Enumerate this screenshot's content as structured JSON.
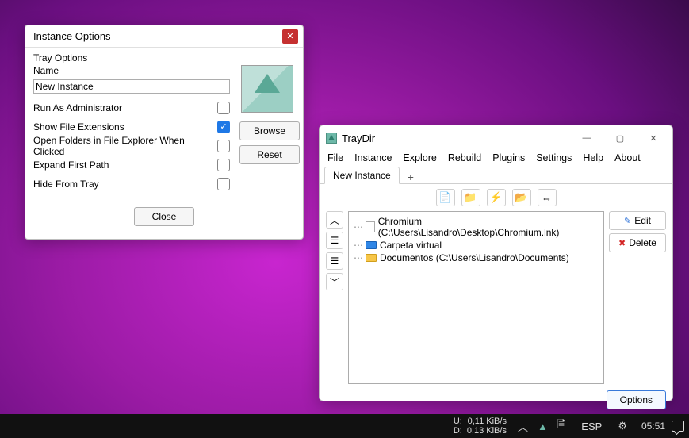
{
  "instance_options": {
    "title": "Instance Options",
    "section_label": "Tray Options",
    "name_label": "Name",
    "name_value": "New Instance",
    "checks": [
      {
        "label": "Run As Administrator",
        "checked": false
      },
      {
        "label": "Show File Extensions",
        "checked": true
      },
      {
        "label": "Open Folders in File Explorer When Clicked",
        "checked": false
      },
      {
        "label": "Expand First Path",
        "checked": false
      },
      {
        "label": "Hide From Tray",
        "checked": false
      }
    ],
    "browse_label": "Browse",
    "reset_label": "Reset",
    "close_label": "Close"
  },
  "main_window": {
    "title": "TrayDir",
    "menu": [
      "File",
      "Instance",
      "Explore",
      "Rebuild",
      "Plugins",
      "Settings",
      "Help",
      "About"
    ],
    "tab_label": "New Instance",
    "icon_names": [
      "new-item",
      "folder-add",
      "folder-flash",
      "folder-blue",
      "align-window"
    ],
    "left_tool_names": [
      "move-up",
      "indent",
      "indent-more",
      "move-down"
    ],
    "tree": [
      {
        "icon": "file",
        "text": "Chromium (C:\\Users\\Lisandro\\Desktop\\Chromium.lnk)"
      },
      {
        "icon": "folder-blue",
        "text": "Carpeta virtual"
      },
      {
        "icon": "folder-yellow",
        "text": "Documentos (C:\\Users\\Lisandro\\Documents)"
      }
    ],
    "edit_label": "Edit",
    "delete_label": "Delete",
    "options_label": "Options"
  },
  "taskbar": {
    "net_label_u": "U:",
    "net_label_d": "D:",
    "net_up": "0,11 KiB/s",
    "net_down": "0,13 KiB/s",
    "lang": "ESP",
    "time": "05:51"
  }
}
